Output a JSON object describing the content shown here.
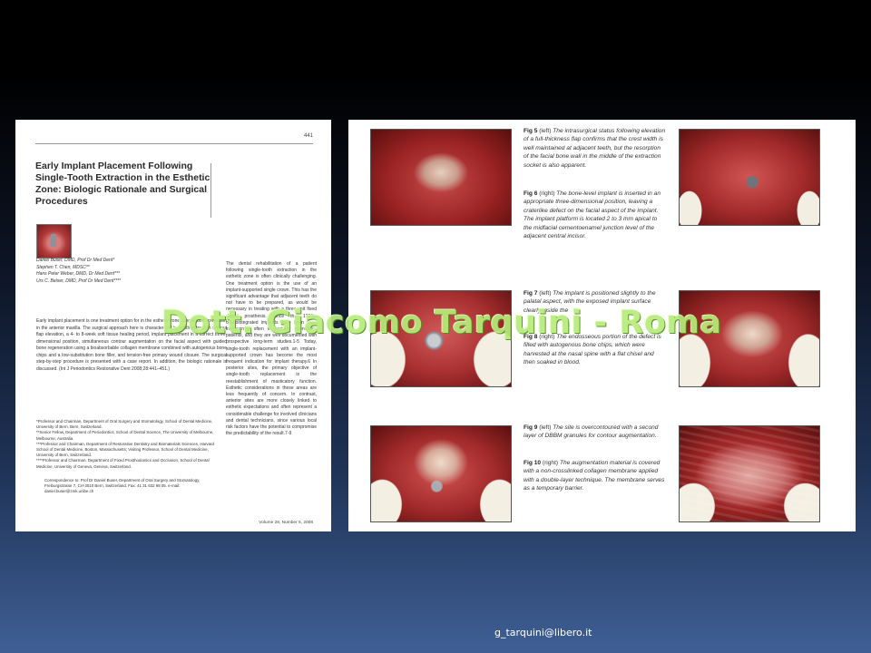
{
  "left_page": {
    "page_number": "441",
    "title": "Early Implant Placement Following Single-Tooth Extraction in the Esthetic Zone: Biologic Rationale and Surgical Procedures",
    "authors": [
      "Daniel Buser, DMD, Prof Dr Med Dent*",
      "Stephen T. Chen, MDSC**",
      "Hans Peter Weber, DMD, Dr Med Dent***",
      "Urs C. Belser, DMD, Prof Dr Med Dent****"
    ],
    "abstract": "Early implant placement is one treatment option for in the esthetic zone. single-tooth extraction in the anterior maxilla. The surgical approach here is characterized by tooth extraction without flap elevation, a 4- to 8-week soft tissue healing period, implant placement in a correct three-dimensional position, simultaneous contour augmentation on the facial aspect with guided bone regeneration using a bioabsorbable collagen membrane combined with autogenous bone chips and a low-substitution bone filler, and tension-free primary wound closure. The surgical step-by-step procedure is presented with a case report. In addition, the biologic rationale is discussed. (Int J Periodontics Restorative Dent 2008;28:441–451.)",
    "footnotes": [
      "*Professor and Chairman, Department of Oral Surgery and Stomatology, School of Dental Medicine, University of Bern, Bern, Switzerland.",
      "**Senior Fellow, Department of Periodontics, School of Dental Science, The University of Melbourne, Melbourne, Australia.",
      "***Professor and Chairman, Department of Restorative Dentistry and Biomaterials Sciences, Harvard School of Dental Medicine, Boston, Massachusetts; Visiting Professor, School of Dental Medicine, University of Bern, Switzerland.",
      "****Professor and Chairman, Department of Fixed Prosthodontics and Occlusion, School of Dental Medicine, University of Geneva, Geneva, Switzerland."
    ],
    "correspondence": "Correspondence to: Prof Dr Daniel Buser, Department of Oral Surgery and Stomatology, Freiburgstrasse 7, CH-3010 Bern, Switzerland. Fax: 41 31 632 98 05. e-mail: daniel.buser@zmk.unibe.ch",
    "body": "The dental rehabilitation of a patient following single-tooth extraction in the esthetic zone is often clinically challenging. One treatment option is the use of an implant-supported single crown. This has the significant advantage that adjacent teeth do not have to be prepared, as would be necessary in treating with a three-unit fixed dental prosthesis. Since the 1980s, osseointegrated implants have been used increasingly often in partially edentulous patients, and they are well documented with prospective long-term studies.1-5 Today, single-tooth replacement with an implant-supported crown has become the most frequent indication for implant therapy.6 In posterior sites, the primary objective of single-tooth replacement is the reestablishment of masticatory function. Esthetic considerations in these areas are less frequently of concern. In contrast, anterior sites are more closely linked to esthetic expectations and often represent a considerable challenge for involved clinicians and dental technicians, since various local risk factors have the potential to compromise the predictability of the result.7-9",
    "volume": "Volume 28, Number 5, 2008"
  },
  "figures": [
    {
      "label": "Fig 5",
      "pos": "(left)",
      "text": "The intrasurgical status following elevation of a full-thickness flap confirms that the crest width is well maintained at adjacent teeth, but the resorption of the facial bone wall in the middle of the extraction socket is also apparent."
    },
    {
      "label": "Fig 6",
      "pos": "(right)",
      "text": "The bone-level implant is inserted in an appropriate three-dimensional position, leaving a craterlike defect on the facial aspect of the implant. The implant platform is located 2 to 3 mm apical to the midfacial cementoenamel junction level of the adjacent central incisor."
    },
    {
      "label": "Fig 7",
      "pos": "(left)",
      "text": "The implant is positioned slightly to the palatal aspect, with the exposed implant surface clearly inside the"
    },
    {
      "label": "Fig 8",
      "pos": "(right)",
      "text": "The endosseous portion of the defect is filled with autogenous bone chips, which were harvested at the nasal spine with a flat chisel and then soaked in blood."
    },
    {
      "label": "Fig 9",
      "pos": "(left)",
      "text": "The site is overcontoured with a second layer of DBBM granules for contour augmentation."
    },
    {
      "label": "Fig 10",
      "pos": "(right)",
      "text": "The augmentation material is covered with a non-crosslinked collagen membrane applied with a double-layer technique. The membrane serves as a temporary barrier."
    }
  ],
  "watermark": "Dott. Giacomo Tarquini - Roma",
  "email": "g_tarquini@libero.it"
}
